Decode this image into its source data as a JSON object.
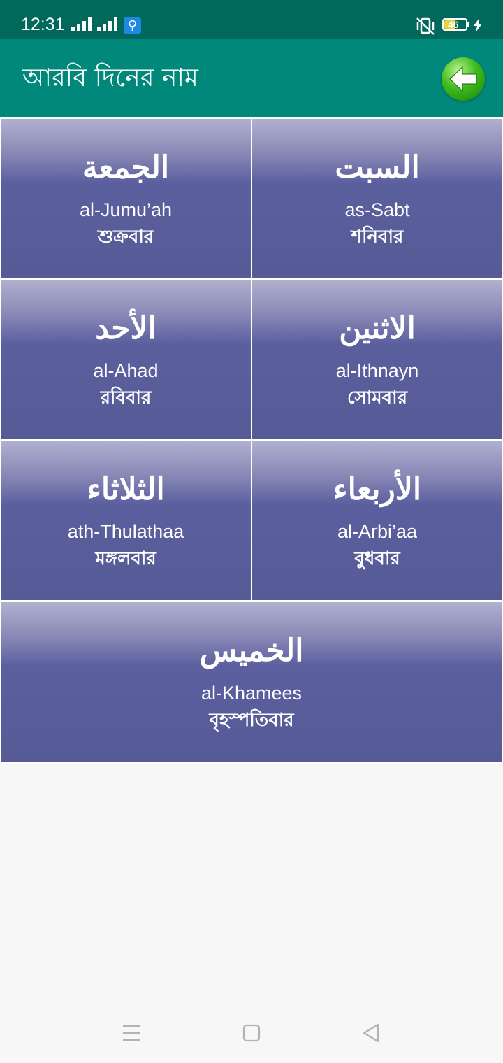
{
  "status_bar": {
    "time": "12:31",
    "battery_level": "46",
    "icons": [
      "signal-icon",
      "signal-icon",
      "usb-debug-icon",
      "vibrate-icon",
      "battery-icon",
      "charging-bolt-icon"
    ]
  },
  "app_bar": {
    "title": "আরবি দিনের নাম",
    "back_icon": "arrow-left-icon"
  },
  "days": [
    {
      "arabic": "الجمعة",
      "translit": "al-Jumu’ah",
      "bangla": "শুক্রবার"
    },
    {
      "arabic": "السبت",
      "translit": "as-Sabt",
      "bangla": "শনিবার"
    },
    {
      "arabic": "الأحد",
      "translit": "al-Ahad",
      "bangla": "রবিবার"
    },
    {
      "arabic": "الاثنين",
      "translit": "al-Ithnayn",
      "bangla": "সোমবার"
    },
    {
      "arabic": "الثلاثاء",
      "translit": "ath-Thulathaa",
      "bangla": "মঙ্গলবার"
    },
    {
      "arabic": "الأربعاء",
      "translit": "al-Arbi’aa",
      "bangla": "বুধবার"
    },
    {
      "arabic": "الخميس",
      "translit": "al-Khamees",
      "bangla": "বৃহস্পতিবার"
    }
  ],
  "nav_bar": {
    "icons": [
      "menu-icon",
      "home-icon",
      "back-icon"
    ]
  },
  "colors": {
    "status_bar": "#00695c",
    "app_bar": "#00897b",
    "tile_dark": "#565a95",
    "tile_light": "#b0b0d0",
    "back_button": "#3fbb1e"
  }
}
